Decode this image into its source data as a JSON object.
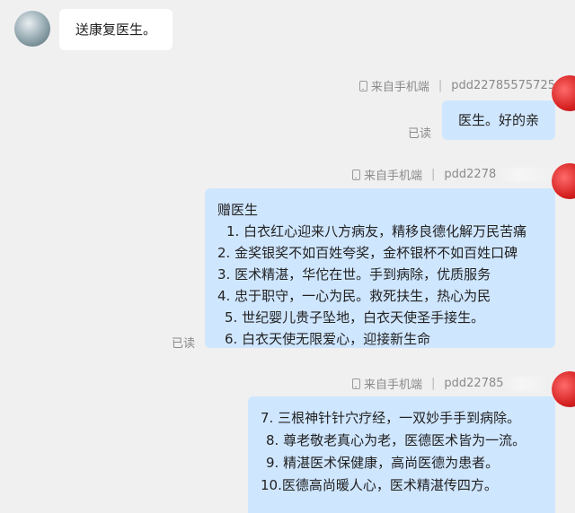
{
  "messages": [
    {
      "text": "送康复医生。"
    },
    {
      "source": "来自手机端",
      "user": "pdd22785575725",
      "text": "医生。好的亲",
      "status": "已读"
    },
    {
      "source": "来自手机端",
      "user": "pdd2278",
      "title": "赠医生",
      "lines": [
        "1. 白衣红心迎来八方病友，精移良德化解万民苦痛",
        "2. 金奖银奖不如百姓夸奖，金杯银杯不如百姓口碑",
        "3. 医术精湛，华佗在世。手到病除，优质服务",
        "4. 忠于职守，一心为民。救死扶生，热心为民",
        "5. 世纪婴儿贵子坠地，白衣天使圣手接生。",
        "6. 白衣天使无限爱心，迎接新生命"
      ],
      "status": "已读"
    },
    {
      "source": "来自手机端",
      "user": "pdd22785",
      "lines": [
        "7. 三根神针针穴疗经，一双妙手手到病除。",
        "8. 尊老敬老真心为老，医德医术皆为一流。",
        "9. 精湛医术保健康，高尚医德为患者。",
        "10.医德高尚暖人心，医术精湛传四方。"
      ]
    }
  ],
  "colors": {
    "page_bg": "#f0f0f0",
    "bubble_left": "#ffffff",
    "bubble_right": "#cfe6ff",
    "meta_text": "#8a8a8a",
    "avatar_right": "#d41f1f"
  }
}
